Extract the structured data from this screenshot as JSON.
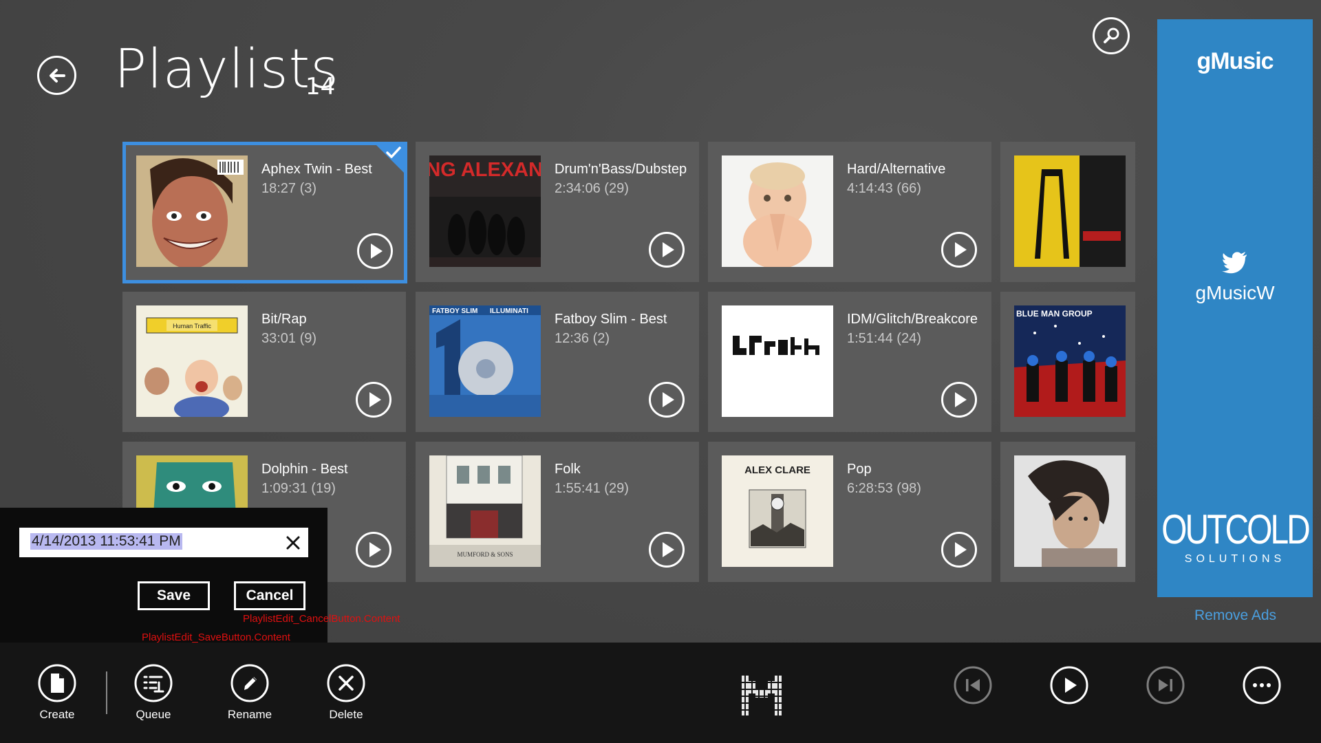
{
  "header": {
    "title": "Playlists",
    "count": "14"
  },
  "playlists": [
    {
      "title": "Aphex Twin - Best",
      "meta": "18:27 (3)",
      "selected": true
    },
    {
      "title": "Drum'n'Bass/Dubstep",
      "meta": "2:34:06 (29)"
    },
    {
      "title": "Hard/Alternative",
      "meta": "4:14:43 (66)"
    },
    {
      "title": "Bit/Rap",
      "meta": "33:01 (9)"
    },
    {
      "title": "Fatboy Slim - Best",
      "meta": "12:36 (2)"
    },
    {
      "title": "IDM/Glitch/Breakcore",
      "meta": "1:51:44 (24)"
    },
    {
      "title": "Dolphin - Best",
      "meta": "1:09:31 (19)"
    },
    {
      "title": "Folk",
      "meta": "1:55:41 (29)"
    },
    {
      "title": "Pop",
      "meta": "6:28:53 (98)"
    }
  ],
  "album_art_text": {
    "asking": "ASKING ALEXANDRIA",
    "fatboy": "FATBOY SLIM",
    "illuminati": "ILLUMINATI",
    "human_traffic": "Human Traffic",
    "alex_clare": "ALEX CLARE",
    "mumford": "MUMFORD & SONS",
    "blue_man": "BLUE MAN GROUP"
  },
  "ad": {
    "logo": "gMusic",
    "twitter_handle": "gMusicW",
    "sponsor_line1": "OUTCOLD",
    "sponsor_line2": "SOLUTIONS",
    "remove_ads": "Remove Ads"
  },
  "edit": {
    "value": "4/14/2013 11:53:41 PM",
    "save_label": "Save",
    "cancel_label": "Cancel",
    "cancel_resource_key": "PlaylistEdit_CancelButton.Content",
    "save_resource_key": "PlaylistEdit_SaveButton.Content"
  },
  "appbar": {
    "create": "Create",
    "queue": "Queue",
    "rename": "Rename",
    "delete": "Delete"
  },
  "colors": {
    "accent": "#3d8fe0",
    "ad_panel": "#2f86c5",
    "tile": "#5b5b5b",
    "debug_text": "#e01010"
  }
}
